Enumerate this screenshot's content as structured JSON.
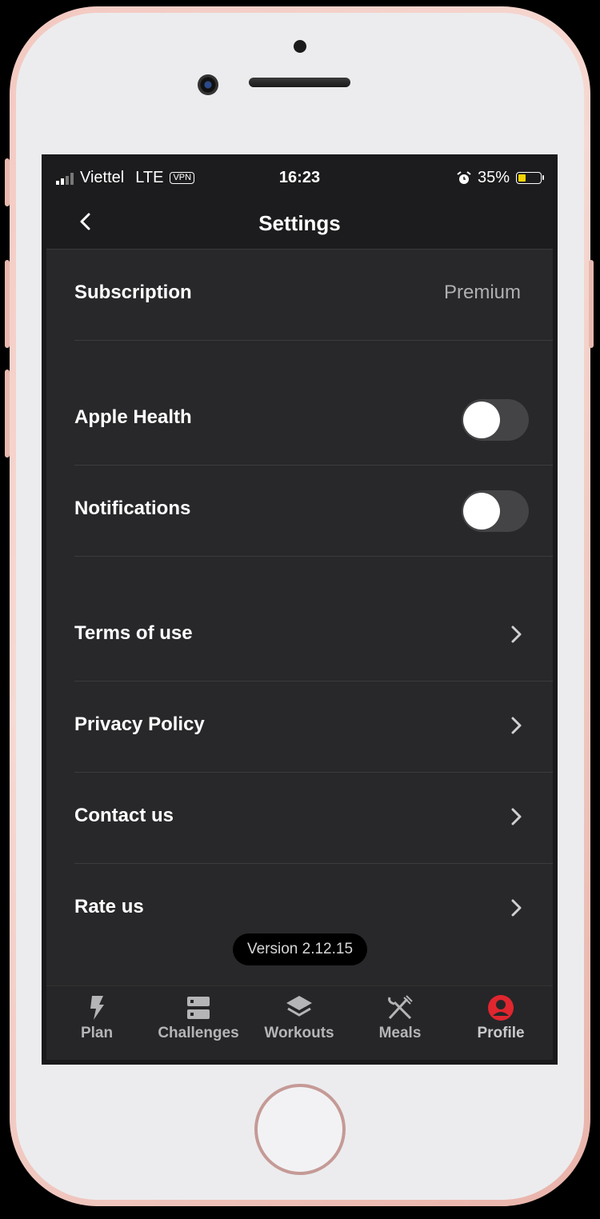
{
  "status_bar": {
    "carrier": "Viettel",
    "network": "LTE",
    "vpn": "VPN",
    "time": "16:23",
    "battery": "35%",
    "icons": [
      "signal-icon",
      "alarm-icon",
      "battery-icon"
    ]
  },
  "header": {
    "title": "Settings",
    "back_icon": "chevron-left-icon"
  },
  "settings": {
    "subscription": {
      "label": "Subscription",
      "value": "Premium"
    },
    "apple_health": {
      "label": "Apple Health",
      "enabled": false
    },
    "notifications": {
      "label": "Notifications",
      "enabled": false
    },
    "terms": {
      "label": "Terms of use"
    },
    "privacy": {
      "label": "Privacy Policy"
    },
    "contact": {
      "label": "Contact us"
    },
    "rate": {
      "label": "Rate us"
    }
  },
  "version": "Version 2.12.15",
  "tabs": [
    {
      "label": "Plan",
      "icon": "lightning-icon"
    },
    {
      "label": "Challenges",
      "icon": "server-icon"
    },
    {
      "label": "Workouts",
      "icon": "layers-icon"
    },
    {
      "label": "Meals",
      "icon": "utensils-icon"
    },
    {
      "label": "Profile",
      "icon": "user-circle-icon",
      "active": true
    }
  ],
  "colors": {
    "accent": "#e0262f",
    "background": "#28282b",
    "bar": "#1c1c1e"
  }
}
